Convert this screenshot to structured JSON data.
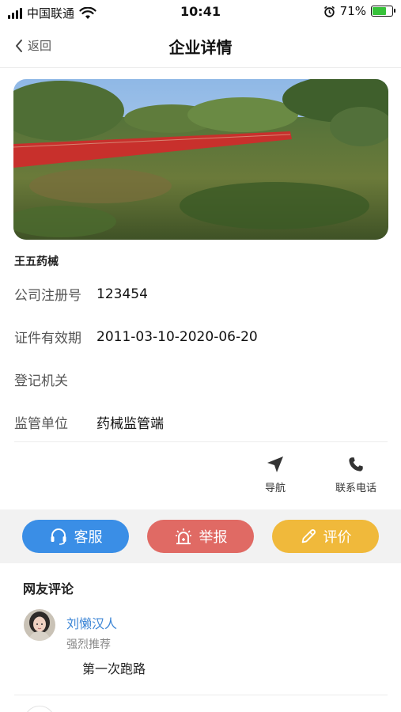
{
  "status_bar": {
    "carrier": "中国联通",
    "time": "10:41",
    "battery": "71%",
    "battery_level": 0.71
  },
  "nav": {
    "back_label": "返回",
    "title": "企业详情"
  },
  "company": {
    "name": "王五药械",
    "fields": [
      {
        "label": "公司注册号",
        "value": "123454"
      },
      {
        "label": "证件有效期",
        "value": "2011-03-10-2020-06-20"
      },
      {
        "label": "登记机关",
        "value": ""
      },
      {
        "label": "监管单位",
        "value": "药械监管端"
      }
    ]
  },
  "actions": {
    "navigate_label": "导航",
    "phone_label": "联系电话"
  },
  "buttons": {
    "service": {
      "label": "客服",
      "color": "#3a8ee6"
    },
    "report": {
      "label": "举报",
      "color": "#e06a64"
    },
    "review": {
      "label": "评价",
      "color": "#f0b93b"
    }
  },
  "comments": {
    "title": "网友评论",
    "items": [
      {
        "name": "刘懒汉人",
        "tag": "强烈推荐",
        "text": "第一次跑路"
      }
    ]
  }
}
